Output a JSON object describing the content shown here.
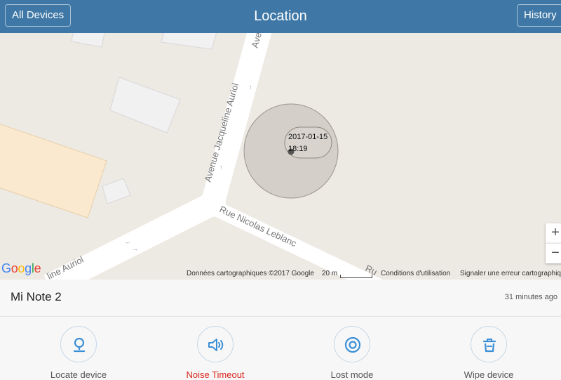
{
  "header": {
    "title": "Location",
    "left_button": "All Devices",
    "right_button": "History"
  },
  "map": {
    "street_labels": [
      "Avenue Jacqueline Auriol",
      "Rue Nicolas Leblanc",
      "Ave",
      "line Auriol",
      "Ru"
    ],
    "pin_date": "2017-01-15",
    "pin_time": "18:19",
    "logo_text": "Google",
    "attribution": "Données cartographiques ©2017 Google",
    "scale_label": "20 m",
    "terms": "Conditions d'utilisation",
    "report": "Signaler une erreur cartographique",
    "zoom_in": "+",
    "zoom_out": "−"
  },
  "device": {
    "name": "Mi Note 2",
    "last_seen": "31 minutes ago"
  },
  "actions": [
    {
      "label": "Locate device",
      "icon": "locate-icon"
    },
    {
      "label": "Noise Timeout",
      "icon": "speaker-icon",
      "color": "#d9231b"
    },
    {
      "label": "Lost mode",
      "icon": "target-icon"
    },
    {
      "label": "Wipe device",
      "icon": "trash-icon"
    }
  ],
  "colors": {
    "header": "#3f78a6",
    "accent_blue": "#3b8fd6",
    "alert_red": "#d9231b"
  }
}
